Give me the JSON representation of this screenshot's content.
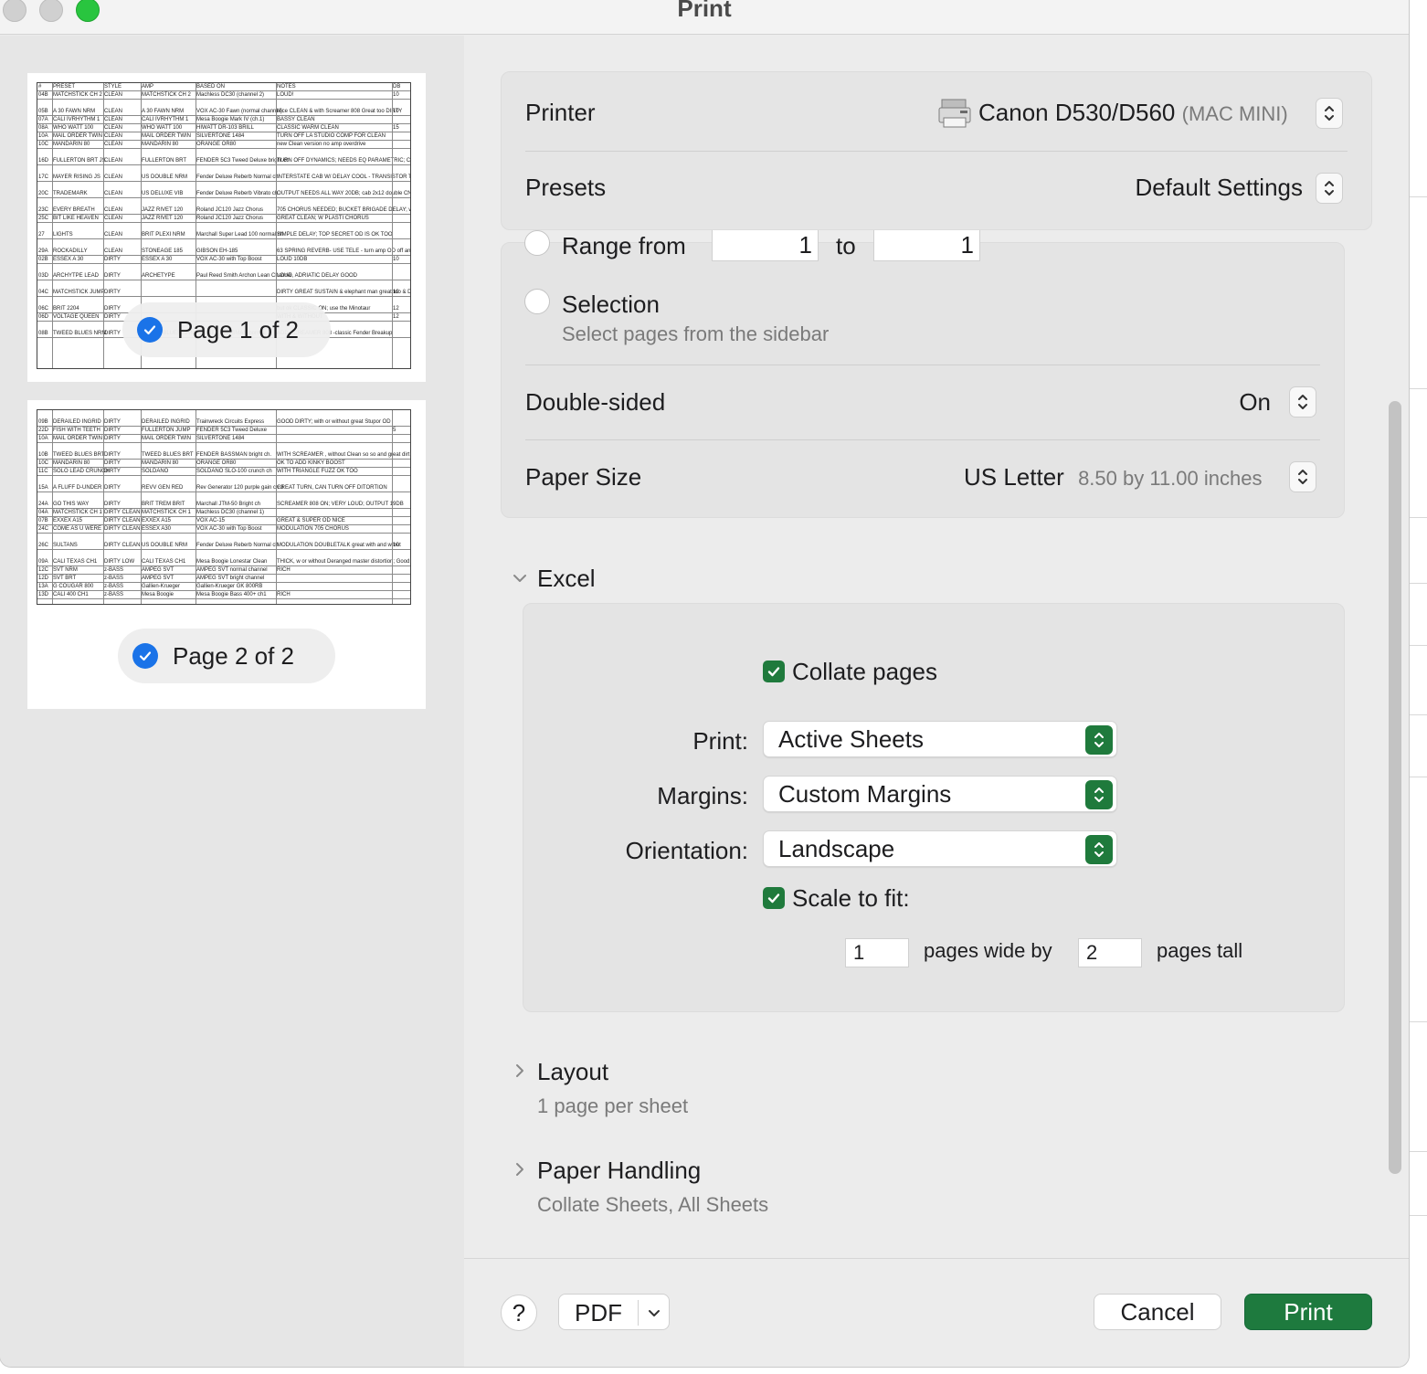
{
  "window": {
    "title": "Print"
  },
  "preview": {
    "pages": [
      {
        "label": "Page 1 of 2",
        "checked": true
      },
      {
        "label": "Page 2 of 2",
        "checked": true
      }
    ],
    "sheet1_rows": [
      [
        "#",
        "PRESET",
        "STYLE",
        "AMP",
        "BASED ON",
        "NOTES",
        "DB"
      ],
      [
        "04B",
        "MATCHSTICK CH 2",
        "CLEAN",
        "MATCHSTICK CH 2",
        "Machless DC30 (channel 2)",
        "LOUD!",
        "10"
      ],
      [
        "05B",
        "A 30 FAWN NRM",
        "CLEAN",
        "A 30 FAWN NRM",
        "VOX AC-30 Fawn (normal channel)",
        "Nice CLEAN & with Screamer 808 Great too DIRTY",
        "10"
      ],
      [
        "07A",
        "CALI IVRHYTHM 1",
        "CLEAN",
        "CALI IVRHYTHM 1",
        "Mesa Boogie Mark IV (ch.1)",
        "BASSY CLEAN",
        ""
      ],
      [
        "08A",
        "WHO WATT 100",
        "CLEAN",
        "WHO WATT 100",
        "HIWATT DR-103 BRILL",
        "CLASSIC WARM CLEAN",
        "15"
      ],
      [
        "10A",
        "MAIL ORDER TWIN",
        "CLEAN",
        "MAIL ORDER TWIN",
        "SILVERTONE 1484",
        "TURN OFF LA STUDIO COMP FOR CLEAN",
        ""
      ],
      [
        "10C",
        "MANDARIN 80",
        "CLEAN",
        "MANDARIN 80",
        "ORANGE OR80",
        "new Clean version no amp overdrive",
        ""
      ],
      [
        "16D",
        "FULLERTON BRT JS",
        "CLEAN",
        "FULLERTON BRT",
        "FENDER 5C3 Tweed Deluxe bright ch",
        "TURN OFF DYNAMICS; NEEDS EQ PARAMETRIC; CAB 1X12 US DELUXE",
        ""
      ],
      [
        "17C",
        "MAYER RISING JS",
        "CLEAN",
        "US DOUBLE NRM",
        "Fender Deluxe Reberb Normal ch",
        "INTERSTATE CAB W/ DELAY COOL - TRANSISTOR TAPE- MUCH BETTER WITH PARAMETRIC OFF",
        ""
      ],
      [
        "20C",
        "TRADEMARK",
        "CLEAN",
        "US DELUXE VIB",
        "Fender Deluxe Reberb Vibrato ch",
        "OUTPUT NEEDS ALL WAY 20DB; cab 2x12 double CNZn, Reverb Room",
        ""
      ],
      [
        "23C",
        "EVERY BREATH",
        "CLEAN",
        "JAZZ RIVET 120",
        "Roland JC120 Jazz Chorus",
        "705 CHORUS NEEDED; BUCKET BRIGADE DELAY; w/out great too",
        ""
      ],
      [
        "25C",
        "BIT LIKE HEAVEN",
        "CLEAN",
        "JAZZ RIVET 120",
        "Roland JC120 Jazz Chorus",
        "GREAT CLEAN; W PLASTI CHORUS",
        ""
      ],
      [
        "27",
        "LIGHTS",
        "CLEAN",
        "BRIT PLEXI NRM",
        "Marchall Super Lead 100 normal ch",
        "SIMPLE DELAY; TOP SECRET OD IS OK TOO",
        ""
      ],
      [
        "29A",
        "ROCKADILLY",
        "CLEAN",
        "STONEAGE 185",
        "GIBSON EH-185",
        "63 SPRING REVERB- USE TELE - turn amp OD off and use Minitaur",
        ""
      ],
      [
        "02B",
        "ESSEX A 30",
        "DIRTY",
        "ESSEX A 30",
        "VOX AC-30 with Top Boost",
        "LOUD 10DB",
        "10"
      ],
      [
        "03D",
        "ARCHYTPE LEAD",
        "DIRTY",
        "ARCHETYPE",
        "Paul Reed Smith Archon Lean Channel",
        "LOUD, ADRIATIC DELAY GOOD",
        ""
      ],
      [
        "04C",
        "MATCHSTICK JUMP",
        "DIRTY",
        "",
        "",
        "DIRTY GREAT SUSTAIN & elephant man great too & Dynamic Kinky Jump & hedgehog D9",
        "10"
      ],
      [
        "06C",
        "BRIT 2204",
        "DIRTY",
        "",
        "",
        "but ok CLASSIC ON; use the Minotaur",
        "12"
      ],
      [
        "06D",
        "VOLTAGE QUEEN",
        "DIRTY",
        "",
        "",
        "WITH & WITHOUT",
        "12"
      ],
      [
        "08B",
        "TWEED BLUES NRM",
        "DIRTY",
        "TWEED BLUES NRM",
        "FENDER BASSMAN normal",
        "ADD SCREAMER 808 -classic Fender Breakup",
        ""
      ]
    ],
    "sheet2_rows": [
      [
        "09B",
        "DERAILED INGRID",
        "DIRTY",
        "DERAILED INGRID",
        "Trainwreck Circuits Express",
        "GOOD DIRTY; with or without great Stupor OD",
        ""
      ],
      [
        "22D",
        "FISH WITH TEETH",
        "DIRTY",
        "FULLERTON JUMP",
        "FENDER 5C3 Tweed Deluxe",
        "",
        "5"
      ],
      [
        "10A",
        "MAIL ORDER TWIN",
        "DIRTY",
        "MAIL ORDER TWIN",
        "SILVERTONE 1484",
        "",
        ""
      ],
      [
        "10B",
        "TWEED BLUES BRT",
        "DIRTY",
        "TWEED BLUES BRT",
        "FENDER BASSMAN bright ch.",
        "WITH SCREAMER , without Clean so so and great dirt without Sceeamer",
        ""
      ],
      [
        "10C",
        "MANDARIN 80",
        "DIRTY",
        "MANDARIN 80",
        "ORANGE OR80",
        "OK TO ADD KINKY BOOST",
        ""
      ],
      [
        "11C",
        "SOLO LEAD CRUNCH",
        "DIRTY",
        "SOLDANO",
        "SOLDANO SLO-100 crunch ch",
        "WITH TRIANGLE FUZZ OK TOO",
        ""
      ],
      [
        "15A",
        "A FLUFF D-UNDER",
        "DIRTY",
        "REVV GEN RED",
        "Rev Generator 120 purple gain ch 3",
        "GREAT TURN, CAN TURN OFF DITORTION",
        ""
      ],
      [
        "24A",
        "GO THIS WAY",
        "DIRTY",
        "BRIT TREM BRIT",
        "Marchall JTM-50 Bright ch",
        "SCREAMER 808 ON; VERY LOUD; OUTPUT 19DB",
        ""
      ],
      [
        "04A",
        "MATCHSTICK CH 1",
        "DIRTY CLEAN",
        "MATCHSTICK CH 1",
        "Machless DC30 (channel 1)",
        "",
        ""
      ],
      [
        "07B",
        "EXXEX A15",
        "DIRTY CLEAN",
        "EXXEX A15",
        "VOX AC-15",
        "GREAT & SUPER OD NICE",
        ""
      ],
      [
        "24C",
        "COME AS U WERE",
        "DIRTY CLEAN",
        "ESSEX A30",
        "VOX AC-30 with Top Boost",
        "MODULATION 705 CHORUS",
        ""
      ],
      [
        "26C",
        "SULTANS",
        "DIRTY CLEAN",
        "US DOUBLE NRM",
        "Fender Deluxe Reberb Normal ch",
        "MODULATION DOUBLETALK great with and w/out",
        "10"
      ],
      [
        "09A",
        "CALI TEXAS CH1",
        "DIRTY LOW",
        "CALI TEXAS CH1",
        "Mesa Boogie Lonestar Clean",
        "THICK, w or without Deranged master distortion; Good: Dynamics Kinky Comp",
        ""
      ],
      [
        "12C",
        "SVT NRM",
        "z-BASS",
        "AMPEG SVT",
        "AMPEG SVT normal channel",
        "RICH",
        ""
      ],
      [
        "12D",
        "SVT BRT",
        "z-BASS",
        "AMPEG SVT",
        "AMPEG SVT bright channel",
        "",
        ""
      ],
      [
        "13A",
        "G COUGAR 800",
        "z-BASS",
        "Gallien-Krueger",
        "Gallien-Krueger GK 800RB",
        "",
        ""
      ],
      [
        "13D",
        "CALI 400 CH1",
        "z-BASS",
        "Mesa Boogie",
        "Mesa Boogie Bass 400+ ch1",
        "RICH",
        ""
      ]
    ]
  },
  "printer": {
    "label": "Printer",
    "name": "Canon D530/D560",
    "host": "(MAC MINI)"
  },
  "presets": {
    "label": "Presets",
    "value": "Default Settings"
  },
  "pages": {
    "range_label": "Range from",
    "range_from": "1",
    "to_label": "to",
    "range_to": "1",
    "selection_label": "Selection",
    "selection_hint": "Select pages from the sidebar"
  },
  "double_sided": {
    "label": "Double-sided",
    "value": "On"
  },
  "paper_size": {
    "label": "Paper Size",
    "value": "US Letter",
    "detail": "8.50 by 11.00 inches"
  },
  "excel": {
    "title": "Excel",
    "collate_label": "Collate pages",
    "collate_checked": true,
    "print_label": "Print:",
    "print_value": "Active Sheets",
    "margins_label": "Margins:",
    "margins_value": "Custom Margins",
    "orientation_label": "Orientation:",
    "orientation_value": "Landscape",
    "scale_label": "Scale to fit:",
    "scale_checked": true,
    "pages_wide": "1",
    "pages_wide_label": "pages wide by",
    "pages_tall": "2",
    "pages_tall_label": "pages tall"
  },
  "layout": {
    "title": "Layout",
    "summary": "1 page per sheet"
  },
  "paper_handling": {
    "title": "Paper Handling",
    "summary": "Collate Sheets, All Sheets"
  },
  "footer": {
    "help_label": "?",
    "pdf_label": "PDF",
    "cancel_label": "Cancel",
    "print_label": "Print"
  },
  "colors": {
    "accent_green": "#1e7a3e",
    "check_blue": "#1a73e8",
    "traffic_green": "#29c53f"
  }
}
